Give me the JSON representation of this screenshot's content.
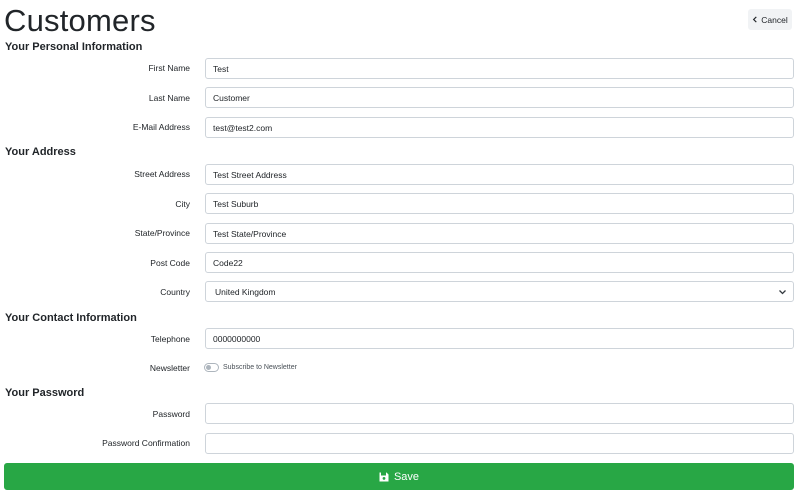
{
  "header": {
    "title": "Customers",
    "cancel_label": "Cancel"
  },
  "sections": {
    "personal": "Your Personal Information",
    "address": "Your Address",
    "contact": "Your Contact Information",
    "password": "Your Password"
  },
  "fields": {
    "first_name": {
      "label": "First Name",
      "value": "Test"
    },
    "last_name": {
      "label": "Last Name",
      "value": "Customer"
    },
    "email": {
      "label": "E-Mail Address",
      "value": "test@test2.com"
    },
    "street": {
      "label": "Street Address",
      "value": "Test Street Address"
    },
    "city": {
      "label": "City",
      "value": "Test Suburb"
    },
    "state": {
      "label": "State/Province",
      "value": "Test State/Province"
    },
    "postcode": {
      "label": "Post Code",
      "value": "Code22"
    },
    "country": {
      "label": "Country",
      "value": "United Kingdom"
    },
    "telephone": {
      "label": "Telephone",
      "value": "0000000000"
    },
    "newsletter": {
      "label": "Newsletter",
      "toggle_label": "Subscribe to Newsletter",
      "checked": false
    },
    "password": {
      "label": "Password",
      "value": ""
    },
    "password_confirm": {
      "label": "Password Confirmation",
      "value": ""
    }
  },
  "actions": {
    "save_label": "Save"
  },
  "colors": {
    "save_button": "#28a745",
    "input_border": "#ced4da",
    "cancel_button_bg": "#f1f3f5"
  },
  "icons": {
    "cancel": "chevron-left-icon",
    "country_select": "chevron-down-icon",
    "save": "floppy-disk-icon"
  }
}
